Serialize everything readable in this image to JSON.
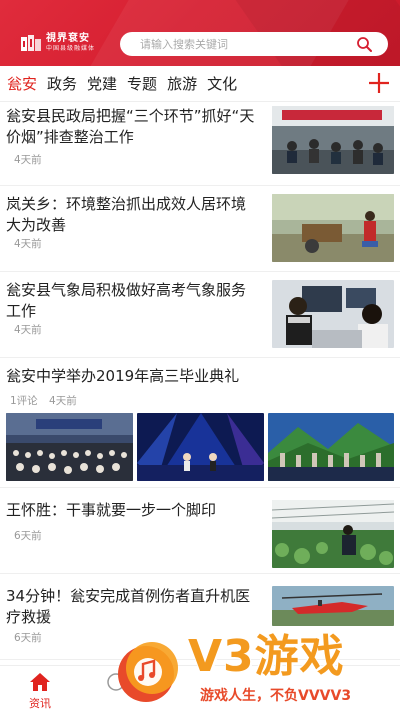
{
  "header": {
    "logo_line1": "視界袞安",
    "logo_line2": "中国县级融媒体",
    "search_placeholder": "请输入搜索关键词"
  },
  "tabs": [
    {
      "label": "瓮安",
      "active": true
    },
    {
      "label": "政务",
      "active": false
    },
    {
      "label": "党建",
      "active": false
    },
    {
      "label": "专题",
      "active": false
    },
    {
      "label": "旅游",
      "active": false
    },
    {
      "label": "文化",
      "active": false
    }
  ],
  "feed": [
    {
      "title_l1": "瓮安县民政局把握“三个环节”抓好“天",
      "title_l2": "价烟”排查整治工作",
      "time": "4天前"
    },
    {
      "title_l1": "岚关乡：环境整治抓出成效人居环境",
      "title_l2": "大为改善",
      "time": "4天前"
    },
    {
      "title_l1": "瓮安县气象局积极做好高考气象服务",
      "title_l2": "工作",
      "time": "4天前"
    },
    {
      "title_l1": "瓮安中学举办2019年高三毕业典礼",
      "comments": "1评论",
      "time": "4天前"
    },
    {
      "title_l1": "王怀胜：干事就要一步一个脚印",
      "time": "6天前"
    },
    {
      "title_l1": "34分钟！瓮安完成首例伤者直升机医",
      "title_l2": "疗救援",
      "time": "6天前"
    }
  ],
  "bottom_nav": {
    "news_label": "资讯"
  },
  "watermark": {
    "brand": "V3游戏",
    "slogan": "游戏人生，不负VVVV3"
  },
  "colors": {
    "accent": "#e0241f",
    "header_red": "#d61f31"
  }
}
